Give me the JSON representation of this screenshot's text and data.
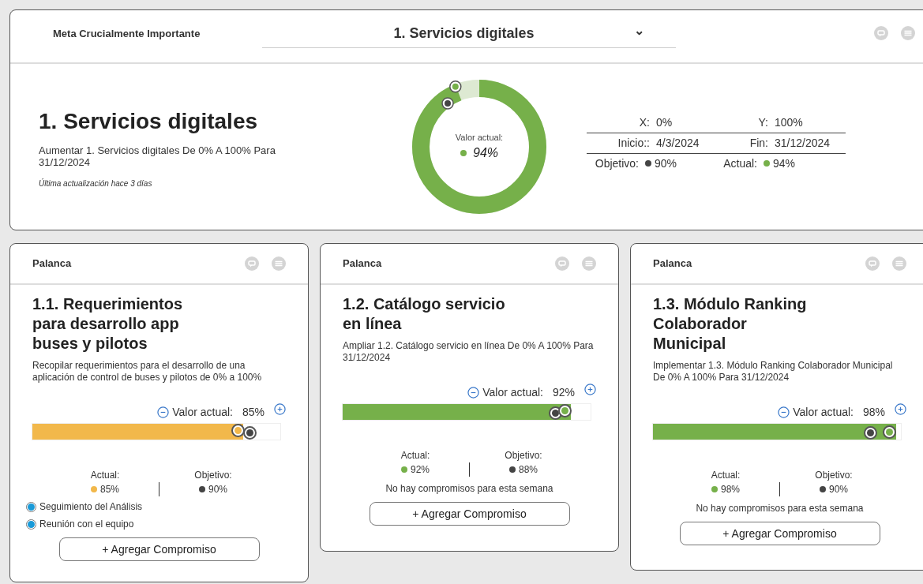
{
  "header": {
    "label": "Meta Crucialmente Importante",
    "selector": {
      "value": "1. Servicios digitales",
      "caret": "⌄"
    }
  },
  "goal": {
    "title": "1. Servicios digitales",
    "description": "Aumentar 1. Servicios digitales De 0% A 100% Para 31/12/2024",
    "updated": "Última actualización hace 3 días",
    "donut": {
      "label": "Valor actual:",
      "value": "94%",
      "color": "#76b04a"
    },
    "stats": [
      {
        "kind": "plain",
        "label1": "X:",
        "value1": "0%",
        "label2": "Y:",
        "value2": "100%"
      },
      {
        "kind": "plain",
        "label1": "Inicio::",
        "value1": "4/3/2024",
        "label2": "Fin:",
        "value2": "31/12/2024"
      },
      {
        "kind": "legend",
        "label1": "Objetivo:",
        "value1": "90%",
        "label2": "Actual:",
        "value2": "94%"
      }
    ]
  },
  "levers": [
    {
      "header": "Palanca",
      "title": "1.1. Requerimientos para desarrollo app buses y pilotos",
      "description": "Recopilar requerimientos para el desarrollo de una aplicación de control de buses y pilotos de 0% a 100%",
      "value_label": "Valor actual:",
      "value": "85%",
      "level": 0.85,
      "color": "#f2b84b",
      "actual_label": "Actual:",
      "actual": "85%",
      "target_label": "Objetivo:",
      "target": "90%",
      "commitments": [
        {
          "label": "Seguimiento del Análisis",
          "selected": true
        },
        {
          "label": "Reunión con el equipo",
          "selected": true
        }
      ],
      "button": "+ Agregar Compromiso"
    },
    {
      "header": "Palanca",
      "title": "1.2. Catálogo servicio en línea",
      "description": "Ampliar 1.2. Catálogo servicio en línea De 0% A 100% Para 31/12/2024",
      "value_label": "Valor actual:",
      "value": "92%",
      "level": 0.92,
      "color": "#76b04a",
      "actual_label": "Actual:",
      "actual": "92%",
      "target_label": "Objetivo:",
      "target": "88%",
      "empty_note": "No hay compromisos para esta semana",
      "button": "+ Agregar Compromiso"
    },
    {
      "header": "Palanca",
      "title": "1.3. Módulo Ranking Colaborador Municipal",
      "description": "Implementar 1.3. Módulo Ranking Colaborador Municipal De 0% A 100% Para 31/12/2024",
      "value_label": "Valor actual:",
      "value": "98%",
      "level": 0.98,
      "color": "#76b04a",
      "actual_label": "Actual:",
      "actual": "98%",
      "target_label": "Objetivo:",
      "target": "90%",
      "empty_note": "No hay compromisos para esta semana",
      "button": "+ Agregar Compromiso"
    }
  ]
}
